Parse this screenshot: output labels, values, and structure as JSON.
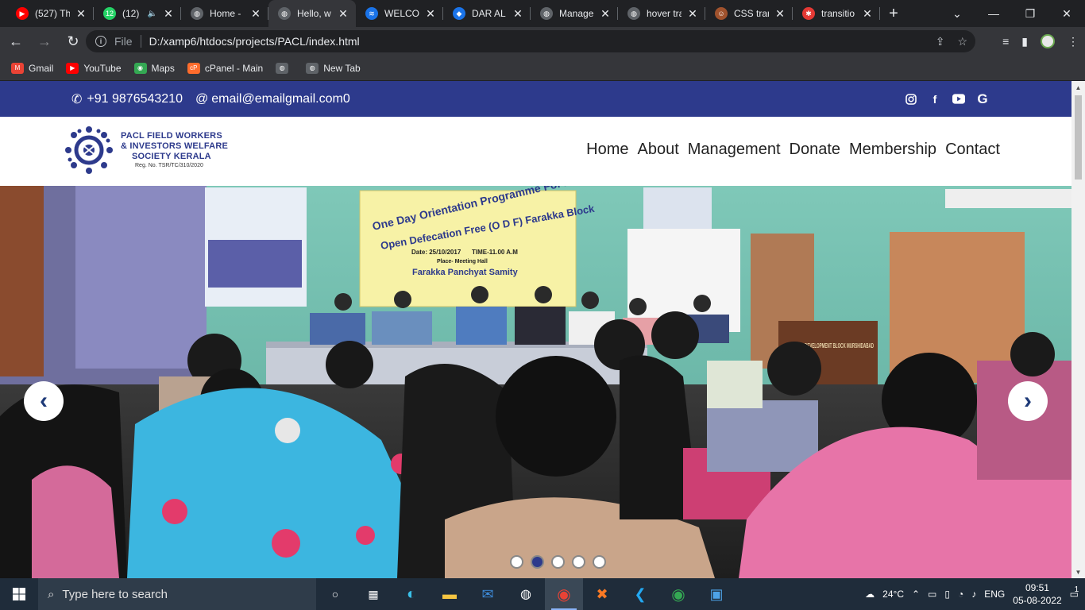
{
  "browser": {
    "tabs": [
      {
        "title": "(527) Th",
        "fav_color": "#ff0000",
        "fav_glyph": "▶"
      },
      {
        "title": "(12)",
        "fav_color": "#25d366",
        "fav_glyph": "12",
        "audio": true
      },
      {
        "title": "Home -",
        "fav_color": "#5f6368",
        "fav_glyph": "◍"
      },
      {
        "title": "Hello, w",
        "fav_color": "#5f6368",
        "fav_glyph": "◍",
        "active": true
      },
      {
        "title": "WELCOM",
        "fav_color": "#1a73e8",
        "fav_glyph": "≋"
      },
      {
        "title": "DAR AL I",
        "fav_color": "#1a73e8",
        "fav_glyph": "◆"
      },
      {
        "title": "Manage",
        "fav_color": "#5f6368",
        "fav_glyph": "◍"
      },
      {
        "title": "hover tra",
        "fav_color": "#5f6368",
        "fav_glyph": "◍"
      },
      {
        "title": "CSS tran",
        "fav_color": "#a0522d",
        "fav_glyph": "☺"
      },
      {
        "title": "transitio",
        "fav_color": "#e53935",
        "fav_glyph": "✱"
      }
    ],
    "address": {
      "scheme": "File",
      "url": "D:/xamp6/htdocs/projects/PACL/index.html"
    },
    "bookmarks": [
      {
        "label": "Gmail",
        "color": "#ea4335",
        "glyph": "M"
      },
      {
        "label": "YouTube",
        "color": "#ff0000",
        "glyph": "▶"
      },
      {
        "label": "Maps",
        "color": "#34a853",
        "glyph": "◉"
      },
      {
        "label": "cPanel - Main",
        "color": "#ff6c2c",
        "glyph": "cP"
      },
      {
        "label": "",
        "color": "#5f6368",
        "glyph": "◍"
      },
      {
        "label": "New Tab",
        "color": "#5f6368",
        "glyph": "◍"
      }
    ]
  },
  "site": {
    "topbar": {
      "phone": "+91 9876543210",
      "email": "email@emailgmail.com0",
      "socials": [
        "instagram-icon",
        "facebook-icon",
        "youtube-icon",
        "google-icon"
      ]
    },
    "logo": {
      "line1": "PACL FIELD WORKERS",
      "line2": "& INVESTORS WELFARE",
      "line3": "SOCIETY KERALA",
      "reg": "Reg. No. TSR/TC/310/2020"
    },
    "nav": [
      "Home",
      "About",
      "Management",
      "Donate",
      "Membership",
      "Contact"
    ],
    "hero": {
      "banner_title": "One Day Orientation Programme For Achieving",
      "banner_sub": "Open Defecation Free (O D F) Farakka Block",
      "banner_date": "Date: 25/10/2017",
      "banner_time": "TIME-11.00 A.M",
      "banner_place": "Place- Meeting Hall",
      "banner_venue": "Farakka Panchyat Samity",
      "podium": "FARAKKA DEVELOPMENT BLOCK MURSHIDABAD",
      "slides": 5,
      "active_slide": 2
    }
  },
  "taskbar": {
    "search_placeholder": "Type here to search",
    "weather": "24°C",
    "lang": "ENG",
    "time": "09:51",
    "date": "05-08-2022",
    "notifications": "1"
  }
}
